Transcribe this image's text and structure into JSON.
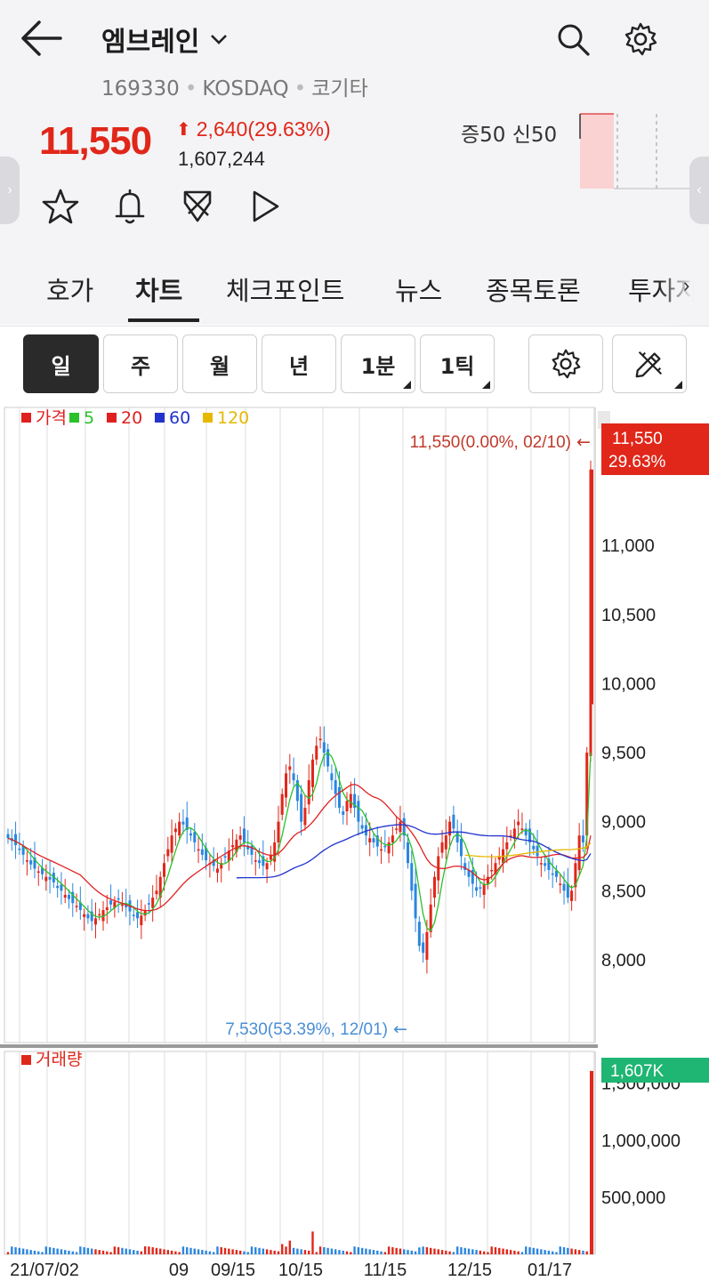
{
  "header": {
    "stock_name": "엠브레인",
    "code": "169330",
    "market": "KOSDAQ",
    "sector": "코기타",
    "price": "11,550",
    "change": "2,640",
    "change_pct": "(29.63%)",
    "volume": "1,607,244",
    "margin_label": "증50  신50"
  },
  "tabs": [
    {
      "label": "호가"
    },
    {
      "label": "차트"
    },
    {
      "label": "체크포인트"
    },
    {
      "label": "뉴스"
    },
    {
      "label": "종목토론"
    },
    {
      "label": "투자자"
    }
  ],
  "periods": [
    "일",
    "주",
    "월",
    "년",
    "1분",
    "1틱"
  ],
  "colors": {
    "up": "#e0271a",
    "down": "#2a86e0",
    "ma5": "#2bc12b",
    "ma20": "#e02020",
    "ma60": "#2233cc",
    "ma120": "#e6b800",
    "volume_badge": "#1fb573"
  },
  "chart_data": {
    "type": "candlestick",
    "legend": [
      {
        "name": "가격",
        "color": "#e02020"
      },
      {
        "name": "5",
        "color": "#2bc12b"
      },
      {
        "name": "20",
        "color": "#e02020"
      },
      {
        "name": "60",
        "color": "#2233cc"
      },
      {
        "name": "120",
        "color": "#e6b800"
      }
    ],
    "y_ticks": [
      "11,000",
      "10,500",
      "10,000",
      "9,500",
      "9,000",
      "8,500",
      "8,000"
    ],
    "y_tick_values": [
      11000,
      10500,
      10000,
      9500,
      9000,
      8500,
      8000
    ],
    "ylim": [
      7400,
      12000
    ],
    "x_ticks": [
      "21/07/02",
      "09",
      "09/15",
      "10/15",
      "11/15",
      "12/15",
      "01/17"
    ],
    "max_annotation": "11,550(0.00%, 02/10)",
    "min_annotation": "7,530(53.39%, 12/01)",
    "last_price_badge": {
      "price": "11,550",
      "pct": "29.63%"
    },
    "closes": [
      8880,
      8860,
      8830,
      8800,
      8760,
      8720,
      8690,
      8660,
      8640,
      8620,
      8600,
      8580,
      8560,
      8520,
      8500,
      8470,
      8440,
      8410,
      8390,
      8360,
      8330,
      8300,
      8280,
      8300,
      8330,
      8360,
      8380,
      8400,
      8420,
      8440,
      8400,
      8380,
      8350,
      8320,
      8300,
      8320,
      8360,
      8400,
      8450,
      8500,
      8600,
      8700,
      8800,
      8900,
      8950,
      9000,
      8980,
      8940,
      8900,
      8850,
      8800,
      8760,
      8720,
      8700,
      8680,
      8660,
      8700,
      8740,
      8790,
      8830,
      8870,
      8900,
      8850,
      8800,
      8760,
      8720,
      8700,
      8680,
      8700,
      8760,
      8850,
      9000,
      9200,
      9350,
      9400,
      9300,
      9150,
      9000,
      9100,
      9300,
      9450,
      9550,
      9600,
      9500,
      9400,
      9300,
      9200,
      9100,
      9050,
      9150,
      9200,
      9100,
      9000,
      8950,
      8900,
      8880,
      8850,
      8820,
      8800,
      8820,
      8850,
      8900,
      8950,
      9000,
      8900,
      8700,
      8500,
      8300,
      8100,
      8050,
      8200,
      8400,
      8600,
      8750,
      8850,
      8900,
      9000,
      8950,
      8850,
      8750,
      8650,
      8600,
      8550,
      8500,
      8520,
      8550,
      8600,
      8650,
      8700,
      8750,
      8800,
      8850,
      8900,
      8950,
      9000,
      8950,
      8900,
      8850,
      8800,
      8750,
      8700,
      8680,
      8650,
      8620,
      8600,
      8550,
      8500,
      8450,
      8500,
      8700,
      8900,
      8850,
      9500,
      11550
    ],
    "ma20_points": [
      [
        8690,
        0
      ],
      [
        8380,
        20
      ],
      [
        8560,
        40
      ],
      [
        8850,
        60
      ],
      [
        9350,
        80
      ],
      [
        8950,
        100
      ],
      [
        8650,
        120
      ],
      [
        8780,
        140
      ],
      [
        8760,
        150
      ]
    ],
    "volume": {
      "label": "거래량",
      "y_ticks": [
        "1,500,000",
        "1,000,000",
        "500,000"
      ],
      "y_tick_values": [
        1500000,
        1000000,
        500000
      ],
      "ymax": 1700000,
      "last_badge": "1,607K",
      "last_value": 1607244
    }
  }
}
